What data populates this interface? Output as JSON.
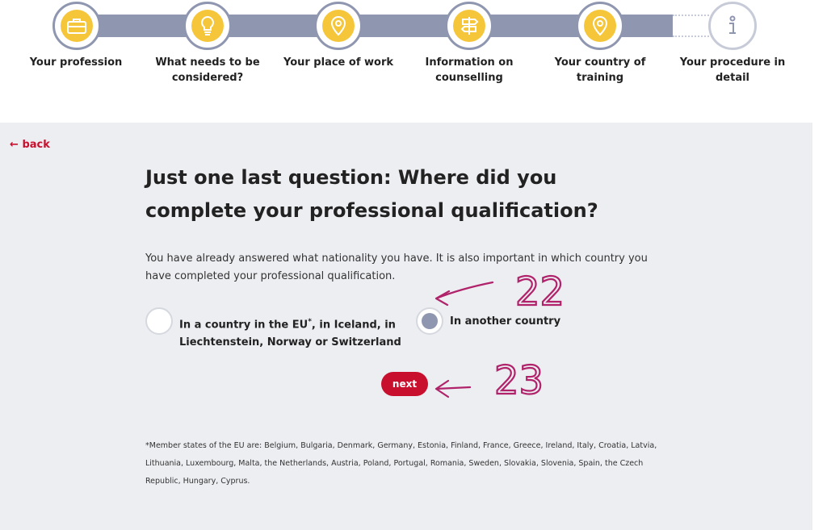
{
  "progress": {
    "steps": [
      {
        "label": "Your profession",
        "icon": "briefcase-icon",
        "state": "done"
      },
      {
        "label": "What needs to be considered?",
        "icon": "lightbulb-icon",
        "state": "done"
      },
      {
        "label": "Your place of work",
        "icon": "map-pin-icon",
        "state": "done"
      },
      {
        "label": "Information on counselling",
        "icon": "signpost-icon",
        "state": "done"
      },
      {
        "label": "Your country of training",
        "icon": "map-pin-icon",
        "state": "current"
      },
      {
        "label": "Your procedure in detail",
        "icon": "info-icon",
        "state": "pending"
      }
    ]
  },
  "nav": {
    "back_label": "back"
  },
  "question": {
    "title": "Just one last question: Where did you complete your professional qualification?",
    "intro": "You have already answered what nationality you have. It is also important in which country you have completed your professional qualification."
  },
  "options": [
    {
      "label_part1": "In a country in the EU",
      "superscript": "*",
      "label_part2": ", in Iceland, in Liechtenstein, Norway or Switzerland",
      "selected": false
    },
    {
      "label": "In another country",
      "selected": true
    }
  ],
  "actions": {
    "next_label": "next"
  },
  "footnote": "*Member states of the EU are: Belgium, Bulgaria, Denmark, Germany, Estonia, Finland, France, Greece, Ireland, Italy, Croatia, Latvia, Lithuania, Luxembourg, Malta, the Netherlands, Austria, Poland, Portugal, Romania, Sweden, Slovakia, Slovenia, Spain, the Czech Republic, Hungary, Cyprus.",
  "annotations": {
    "first": "22",
    "second": "23"
  },
  "colors": {
    "accent_red": "#c8102e",
    "track": "#8f96b0",
    "icon_yellow": "#f6c63a",
    "panel_bg": "#edeef2",
    "annotation_ink": "#b0236b"
  }
}
